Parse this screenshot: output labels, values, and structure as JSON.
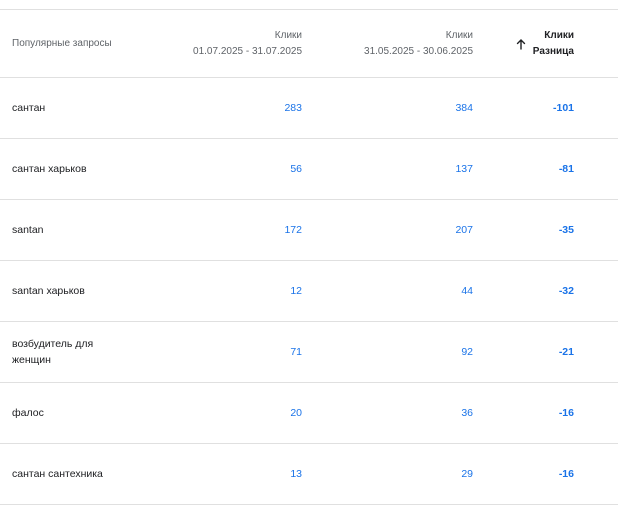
{
  "header": {
    "query_label": "Популярные запросы",
    "current": {
      "metric": "Клики",
      "range": "01.07.2025 - 31.07.2025"
    },
    "previous": {
      "metric": "Клики",
      "range": "31.05.2025 - 30.06.2025"
    },
    "difference": {
      "metric": "Клики",
      "label": "Разница",
      "sort_icon": "arrow-up-icon"
    }
  },
  "rows": [
    {
      "query": "сантан",
      "current": "283",
      "previous": "384",
      "diff": "-101"
    },
    {
      "query": "сантан харьков",
      "current": "56",
      "previous": "137",
      "diff": "-81"
    },
    {
      "query": "santan",
      "current": "172",
      "previous": "207",
      "diff": "-35"
    },
    {
      "query": "santan харьков",
      "current": "12",
      "previous": "44",
      "diff": "-32"
    },
    {
      "query": "возбудитель для женщин",
      "current": "71",
      "previous": "92",
      "diff": "-21"
    },
    {
      "query": "фалос",
      "current": "20",
      "previous": "36",
      "diff": "-16"
    },
    {
      "query": "сантан сантехника",
      "current": "13",
      "previous": "29",
      "diff": "-16"
    }
  ],
  "colors": {
    "link": "#1a73e8",
    "text": "#202124",
    "muted": "#5f6368",
    "divider": "#e0e0e0"
  }
}
